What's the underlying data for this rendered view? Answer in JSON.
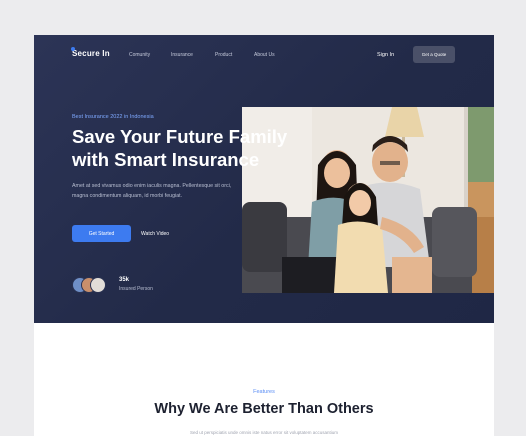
{
  "nav": {
    "logo": "Secure In",
    "links": [
      "Comunity",
      "Insurance",
      "Product",
      "About Us"
    ],
    "signin": "Sign In",
    "cta": "Get a Quote"
  },
  "hero": {
    "tagline": "Best Insurance 2022 in Indonesia",
    "title_line1": "Save Your Future Family",
    "title_line2": "with Smart Insurance",
    "desc": "Amet at sed vivamus odio enim iaculis magna. Pellentesque sit orci, magna condimentum aliquam, id morbi feugiat.",
    "primary_btn": "Get Started",
    "secondary_btn": "Watch Video",
    "stat_number": "35k",
    "stat_label": "Insured Person"
  },
  "features": {
    "eyebrow": "Features",
    "title": "Why We Are Better Than Others",
    "subtitle": "Sed ut perspiciatis unde omnis iste natus error sit voluptatem accusantium"
  },
  "colors": {
    "hero_bg": "#252d4c",
    "accent": "#3d7bf0",
    "page_bg": "#ececee"
  }
}
